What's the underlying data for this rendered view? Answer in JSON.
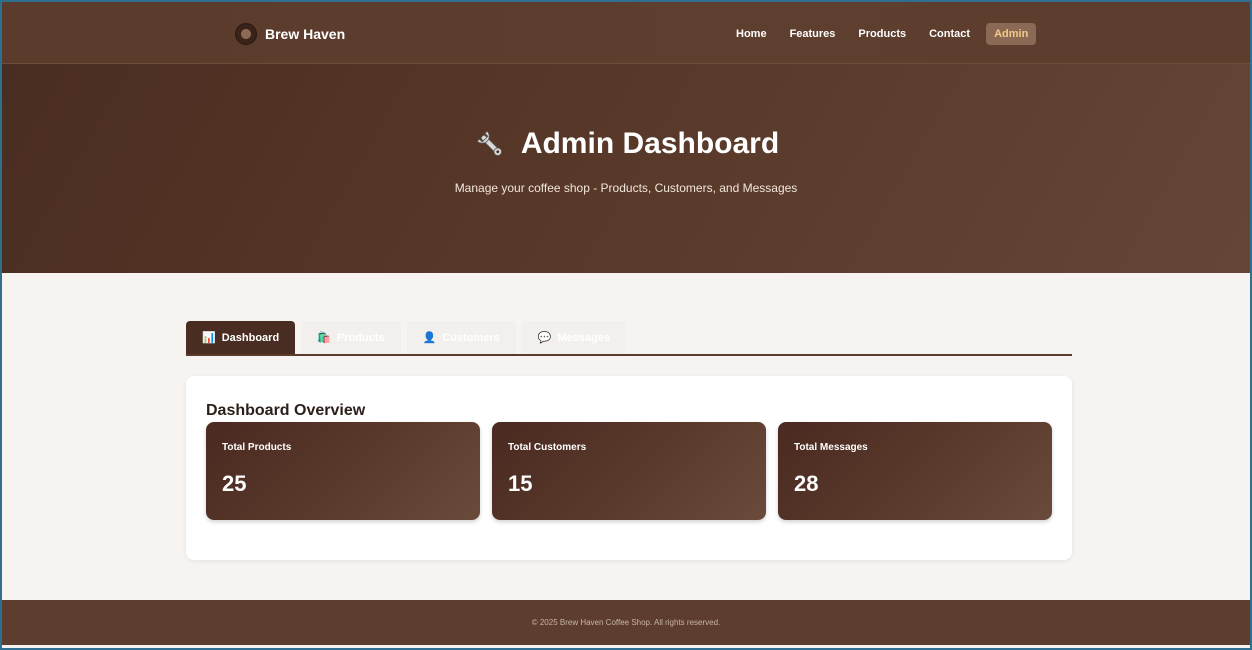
{
  "brand": {
    "name": "Brew Haven",
    "logo_icon": "coffee-cup-icon"
  },
  "nav": {
    "items": [
      {
        "label": "Home"
      },
      {
        "label": "Features"
      },
      {
        "label": "Products"
      },
      {
        "label": "Contact"
      },
      {
        "label": "Admin",
        "active": true
      }
    ]
  },
  "hero": {
    "title": "Admin Dashboard",
    "title_icon": "wrench-icon",
    "subtitle": "Manage your coffee shop - Products, Customers, and Messages"
  },
  "tabs": [
    {
      "label": "Dashboard",
      "icon": "bar-chart-icon",
      "active": true
    },
    {
      "label": "Products",
      "icon": "shopping-bags-icon",
      "active": false
    },
    {
      "label": "Customers",
      "icon": "user-silhouette-icon",
      "active": false
    },
    {
      "label": "Messages",
      "icon": "speech-bubble-icon",
      "active": false
    }
  ],
  "overview": {
    "title": "Dashboard Overview",
    "stats": [
      {
        "label": "Total Products",
        "value": "25"
      },
      {
        "label": "Total Customers",
        "value": "15"
      },
      {
        "label": "Total Messages",
        "value": "28"
      }
    ]
  },
  "footer": {
    "text": "© 2025 Brew Haven Coffee Shop. All rights reserved."
  },
  "colors": {
    "primary_brown": "#5a3b2c",
    "dark_brown": "#4a2d22",
    "accent_gold": "#f4c98a",
    "page_bg": "#f6f3f0"
  }
}
